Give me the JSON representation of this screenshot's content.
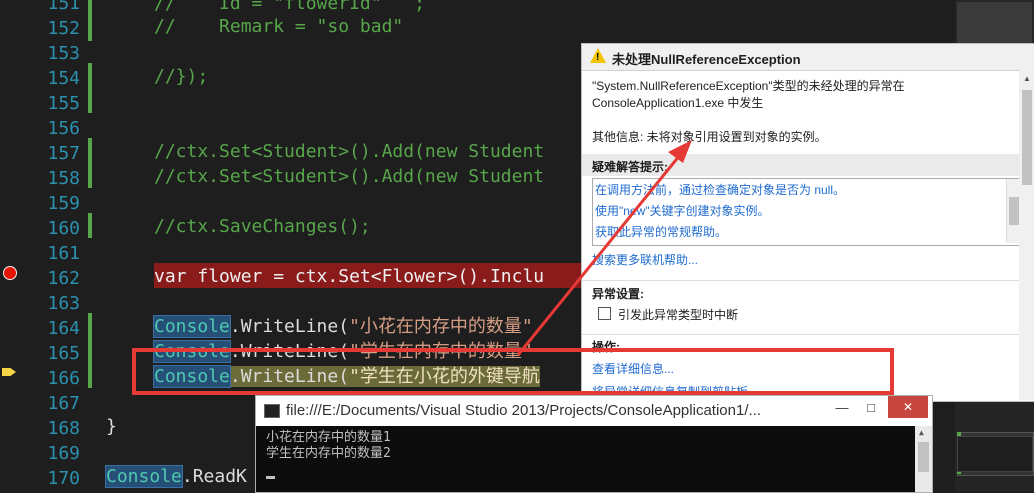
{
  "editor": {
    "line_numbers": [
      "151",
      "152",
      "153",
      "154",
      "155",
      "156",
      "157",
      "158",
      "159",
      "160",
      "161",
      "162",
      "163",
      "164",
      "165",
      "166",
      "167",
      "168",
      "169",
      "170"
    ],
    "lines": {
      "l151": "//    Id = \"flowerId\"   ;",
      "l152": "//    Remark = \"so bad\"",
      "l154": "//});",
      "l157a": "//ctx.Set<Student>().Add(new Student",
      "l158a": "//ctx.Set<Student>().Add(new Student",
      "l160": "//ctx.SaveChanges();",
      "l162_kw": "var",
      "l162_rest": " flower = ctx.Set<Flower>().Inclu",
      "l164_cls": "Console",
      "l164_mid": ".WriteLine(",
      "l164_str": "\"小花在内存中的数量\"",
      "l165_cls": "Console",
      "l165_mid": ".WriteLine(",
      "l165_str": "\"学生在内存中的数量\"",
      "l166_cls": "Console",
      "l166_mid": ".WriteLine(",
      "l166_str": "\"学生在小花的外键导航",
      "l168": "}",
      "l170_cls": "Console",
      "l170_rest": ".ReadK"
    }
  },
  "exception": {
    "title": "未处理NullReferenceException",
    "message_line1": "\"System.NullReferenceException\"类型的未经处理的异常在",
    "message_line2": "ConsoleApplication1.exe 中发生",
    "additional_info": "其他信息: 未将对象引用设置到对象的实例。",
    "troubleshooting_title": "疑难解答提示:",
    "tips": [
      "在调用方法前，通过检查确定对象是否为 null。",
      "使用\"new\"关键字创建对象实例。",
      "获取此异常的常规帮助。"
    ],
    "search_online": "搜索更多联机帮助...",
    "exception_settings_title": "异常设置:",
    "break_checkbox_label": "引发此异常类型时中断",
    "actions_title": "操作:",
    "view_detail": "查看详细信息...",
    "copy_detail": "将异常详细信息复制到剪贴板"
  },
  "console": {
    "title": "file:///E:/Documents/Visual Studio 2013/Projects/ConsoleApplication1/...",
    "output": [
      "小花在内存中的数量1",
      "学生在内存中的数量2"
    ],
    "minimize": "—",
    "maximize": "□",
    "close": "✕"
  },
  "colors": {
    "highlight_border": "#e53935",
    "arrow": "#e53935",
    "breakpoint": "#e51400"
  }
}
